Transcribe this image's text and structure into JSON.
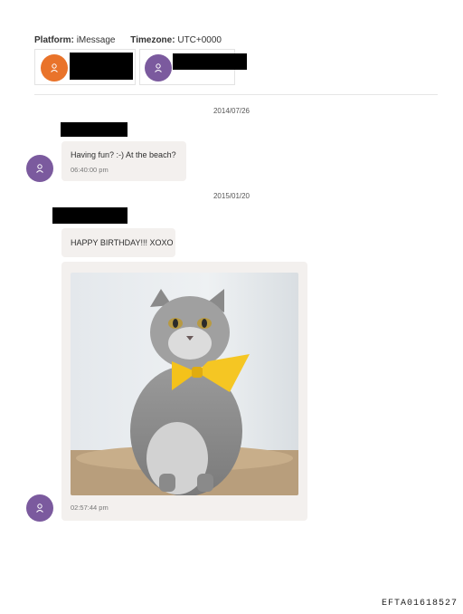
{
  "header": {
    "platform_label": "Platform:",
    "platform_value": "iMessage",
    "timezone_label": "Timezone:",
    "timezone_value": "UTC+0000"
  },
  "participants": [
    {
      "avatar_color": "#e9732a",
      "avatar_icon": "user-icon"
    },
    {
      "avatar_color": "#7b5a9e",
      "avatar_icon": "user-icon"
    }
  ],
  "conversation": [
    {
      "date": "2014/07/26",
      "messages": [
        {
          "text": "Having fun? :-) At the beach?",
          "time": "06:40:00 pm"
        }
      ]
    },
    {
      "date": "2015/01/20",
      "messages": [
        {
          "text": "HAPPY BIRTHDAY!!! XOXO",
          "time": ""
        },
        {
          "attachment": "photo of gray cat wearing yellow bow tie",
          "time": "02:57:44 pm"
        }
      ]
    }
  ],
  "footer": {
    "document_id": "EFTA01618527"
  }
}
